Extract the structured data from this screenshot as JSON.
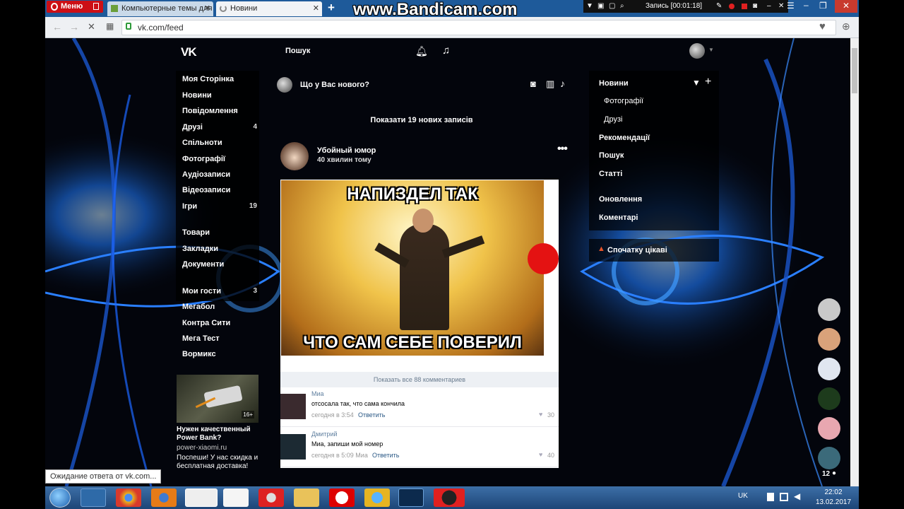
{
  "browser": {
    "menu_label": "Меню",
    "tabs": [
      {
        "label": "Компьютерные темы для"
      },
      {
        "label": "Новини"
      }
    ],
    "url": "vk.com/feed",
    "status": "Ожидание ответа от vk.com..."
  },
  "recorder": {
    "watermark": "www.Bandicam.com",
    "record_label": "Запись [00:01:18]"
  },
  "vk": {
    "search_label": "Пошук",
    "sidebar": [
      {
        "label": "Моя Сторінка",
        "count": ""
      },
      {
        "label": "Новини",
        "count": ""
      },
      {
        "label": "Повідомлення",
        "count": ""
      },
      {
        "label": "Друзі",
        "count": "4"
      },
      {
        "label": "Спільноти",
        "count": ""
      },
      {
        "label": "Фотографії",
        "count": ""
      },
      {
        "label": "Аудіозаписи",
        "count": ""
      },
      {
        "label": "Відеозаписи",
        "count": ""
      },
      {
        "label": "Ігри",
        "count": "19"
      },
      {
        "label": "Товари",
        "count": ""
      },
      {
        "label": "Закладки",
        "count": ""
      },
      {
        "label": "Документи",
        "count": ""
      },
      {
        "label": "Мои гости",
        "count": "3"
      },
      {
        "label": "Мегабол",
        "count": ""
      },
      {
        "label": "Контра Сити",
        "count": ""
      },
      {
        "label": "Мега Тест",
        "count": ""
      },
      {
        "label": "Вормикс",
        "count": ""
      }
    ],
    "ad": {
      "title": "Нужен качественный Power Bank?",
      "domain": "power-xiaomi.ru",
      "text": "Поспеши! У нас скидка и бесплатная доставка!",
      "badge": "16+"
    },
    "composer_placeholder": "Що у Вас нового?",
    "new_posts": "Показати 19 нових записів",
    "post": {
      "author": "Убойный юмор",
      "time": "40 хвилин тому",
      "meme_top": "НАПИЗДЕЛ ТАК",
      "meme_bottom": "ЧТО САМ СЕБЕ ПОВЕРИЛ",
      "show_all": "Показать все 88 комментариев",
      "comments": [
        {
          "author": "Миа",
          "text": "отсосала так, что сама кончила",
          "meta": "сегодня в 3:54",
          "reply": "Ответить",
          "likes": "30"
        },
        {
          "author": "Дмитрий",
          "text": "Миа, запиши мой номер",
          "meta": "сегодня в 5:09 Миа",
          "reply": "Ответить",
          "likes": "40"
        }
      ]
    },
    "right_menu": {
      "groups": [
        [
          {
            "label": "Новини"
          },
          {
            "label": "Фотографії"
          },
          {
            "label": "Друзі"
          },
          {
            "label": "Рекомендації"
          },
          {
            "label": "Пошук"
          },
          {
            "label": "Статті"
          }
        ],
        [
          {
            "label": "Оновлення"
          },
          {
            "label": "Коментарі"
          }
        ]
      ],
      "interesting": "Спочатку цікаві"
    },
    "friends_online_count": "12"
  },
  "taskbar": {
    "lang": "UK",
    "time": "22:02",
    "date": "13.02.2017"
  },
  "colors": {
    "accent": "#1e5a9a",
    "opera_red": "#cc0f16",
    "vk_bg": "#03050c",
    "blue_glow": "#1a6cff"
  }
}
